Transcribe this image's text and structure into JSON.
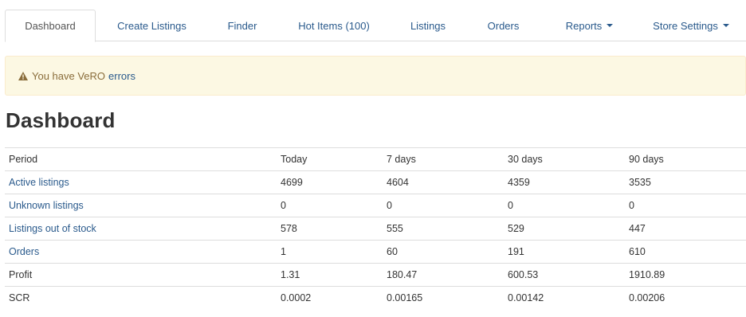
{
  "nav": {
    "tabs": [
      {
        "label": "Dashboard"
      },
      {
        "label": "Create Listings"
      },
      {
        "label": "Finder"
      },
      {
        "label": "Hot Items (100)"
      },
      {
        "label": "Listings"
      },
      {
        "label": "Orders"
      },
      {
        "label": "Reports"
      },
      {
        "label": "Store Settings"
      }
    ]
  },
  "alert": {
    "text": "You have VeRO",
    "link": "errors",
    "color": "#8a6d3b",
    "background": "#fcf8e3"
  },
  "page": {
    "title": "Dashboard"
  },
  "table": {
    "headers": [
      "Period",
      "Today",
      "7 days",
      "30 days",
      "90 days"
    ],
    "rows": [
      {
        "label": "Active listings",
        "values": [
          "4699",
          "4604",
          "4359",
          "3535"
        ]
      },
      {
        "label": "Unknown listings",
        "values": [
          "0",
          "0",
          "0",
          "0"
        ]
      },
      {
        "label": "Listings out of stock",
        "values": [
          "578",
          "555",
          "529",
          "447"
        ]
      },
      {
        "label": "Orders",
        "values": [
          "1",
          "60",
          "191",
          "610"
        ]
      },
      {
        "label": "Profit",
        "values": [
          "1.31",
          "180.47",
          "600.53",
          "1910.89"
        ]
      },
      {
        "label": "SCR",
        "values": [
          "0.0002",
          "0.00165",
          "0.00142",
          "0.00206"
        ]
      }
    ]
  },
  "colors": {
    "link": "#2a5a8c",
    "border": "#dddddd"
  }
}
